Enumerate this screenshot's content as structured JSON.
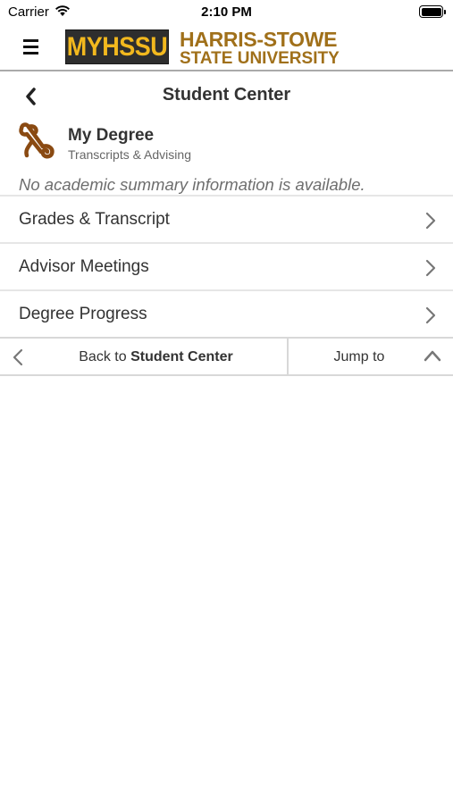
{
  "status_bar": {
    "carrier": "Carrier",
    "time": "2:10 PM"
  },
  "header": {
    "logo_primary": "MYHSSU",
    "logo_name_line1": "HARRIS-STOWE",
    "logo_name_line2": "STATE UNIVERSITY"
  },
  "page": {
    "title": "Student Center"
  },
  "section": {
    "title": "My Degree",
    "subtitle": "Transcripts & Advising",
    "icon": "diploma-scroll-icon"
  },
  "notice": "No academic summary information is available.",
  "items": [
    {
      "label": "Grades & Transcript"
    },
    {
      "label": "Advisor Meetings"
    },
    {
      "label": "Degree Progress"
    }
  ],
  "bottom_bar": {
    "back_prefix": "Back to",
    "back_target": "Student Center",
    "jump_label": "Jump to"
  },
  "colors": {
    "brand_gold": "#f2b81e",
    "brand_brown": "#a0701a",
    "icon_brown": "#8a4a12"
  }
}
